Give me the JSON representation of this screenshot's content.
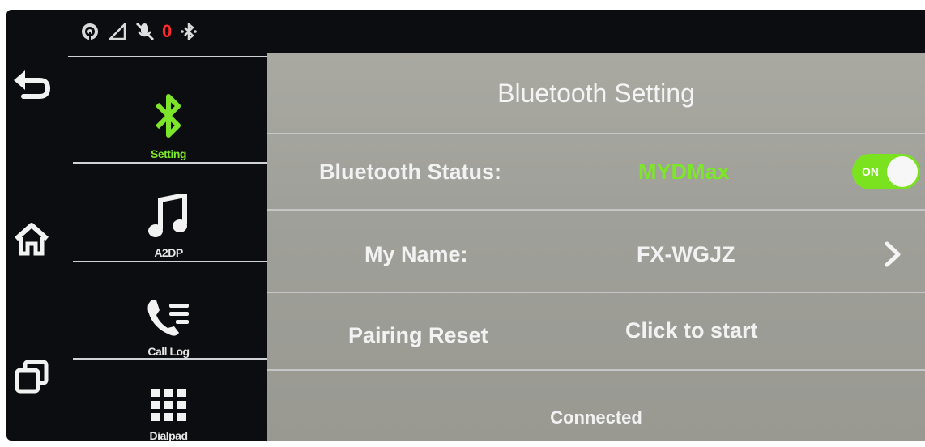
{
  "statusbar": {
    "icons": [
      "hotspot-icon",
      "signal-icon",
      "mic-muted-icon",
      "bluetooth-status-icon"
    ],
    "notification_count": "0"
  },
  "rail": {
    "buttons": [
      "back-icon",
      "home-icon",
      "recent-apps-icon"
    ]
  },
  "categories": [
    {
      "label": "Setting",
      "icon": "bluetooth-icon",
      "active": true
    },
    {
      "label": "A2DP",
      "icon": "music-note-icon",
      "active": false
    },
    {
      "label": "Call Log",
      "icon": "call-log-icon",
      "active": false
    },
    {
      "label": "Dialpad",
      "icon": "dialpad-icon",
      "active": false
    }
  ],
  "panel": {
    "title": "Bluetooth Setting",
    "bluetooth_status": {
      "label": "Bluetooth Status:",
      "value": "MYDMax",
      "toggle_label": "ON",
      "toggle_on": true
    },
    "my_name": {
      "label": "My Name:",
      "value": "FX-WGJZ"
    },
    "pairing_reset": {
      "label": "Pairing Reset",
      "value": "Click to start"
    },
    "connection_status": "Connected"
  },
  "colors": {
    "accent_green": "#7ee62a",
    "panel_bg": "#a4a49e",
    "sidebar_bg": "#0b0d10",
    "notification_red": "#ff2a2a"
  }
}
